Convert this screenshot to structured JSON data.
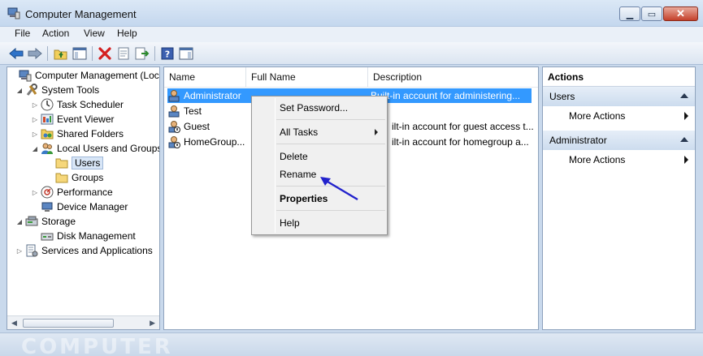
{
  "window": {
    "title": "Computer Management"
  },
  "menu": [
    "File",
    "Action",
    "View",
    "Help"
  ],
  "toolbar": {
    "icons": [
      "back-arrow-icon",
      "forward-arrow-icon",
      "up-folder-icon",
      "show-hide-tree-icon",
      "delete-icon",
      "properties-icon",
      "export-list-icon",
      "help-icon",
      "show-hide-action-pane-icon"
    ]
  },
  "tree": {
    "items": [
      {
        "label": "Computer Management (Local",
        "level": 0,
        "expander": "",
        "icon": "computer-management-icon"
      },
      {
        "label": "System Tools",
        "level": 1,
        "expander": "◢",
        "icon": "system-tools-icon"
      },
      {
        "label": "Task Scheduler",
        "level": 2,
        "expander": "▷",
        "icon": "task-scheduler-icon"
      },
      {
        "label": "Event Viewer",
        "level": 2,
        "expander": "▷",
        "icon": "event-viewer-icon"
      },
      {
        "label": "Shared Folders",
        "level": 2,
        "expander": "▷",
        "icon": "shared-folders-icon"
      },
      {
        "label": "Local Users and Groups",
        "level": 2,
        "expander": "◢",
        "icon": "local-users-groups-icon"
      },
      {
        "label": "Users",
        "level": 3,
        "expander": "",
        "icon": "folder-icon",
        "selected": true
      },
      {
        "label": "Groups",
        "level": 3,
        "expander": "",
        "icon": "folder-icon"
      },
      {
        "label": "Performance",
        "level": 2,
        "expander": "▷",
        "icon": "performance-icon"
      },
      {
        "label": "Device Manager",
        "level": 2,
        "expander": "",
        "icon": "device-manager-icon"
      },
      {
        "label": "Storage",
        "level": 1,
        "expander": "◢",
        "icon": "storage-icon"
      },
      {
        "label": "Disk Management",
        "level": 2,
        "expander": "",
        "icon": "disk-management-icon"
      },
      {
        "label": "Services and Applications",
        "level": 1,
        "expander": "▷",
        "icon": "services-applications-icon"
      }
    ]
  },
  "list": {
    "columns": [
      "Name",
      "Full Name",
      "Description"
    ],
    "rows": [
      {
        "name": "Administrator",
        "full_name": "",
        "description": "Built-in account for administering...",
        "selected": true
      },
      {
        "name": "Test",
        "full_name": "",
        "description": ""
      },
      {
        "name": "Guest",
        "full_name": "",
        "description": "ilt-in account for guest access t..."
      },
      {
        "name": "HomeGroup...",
        "full_name": "",
        "description": "ilt-in account for homegroup a..."
      }
    ]
  },
  "context_menu": {
    "items": [
      "Set Password...",
      "All Tasks",
      "Delete",
      "Rename",
      "Properties",
      "Help"
    ]
  },
  "actions": {
    "title": "Actions",
    "sections": [
      {
        "label": "Users",
        "items": [
          "More Actions"
        ]
      },
      {
        "label": "Administrator",
        "items": [
          "More Actions"
        ]
      }
    ]
  },
  "watermark": "COMPUTER",
  "colors": {
    "selection": "#3399ff",
    "annotation_arrow": "#2222cc"
  }
}
